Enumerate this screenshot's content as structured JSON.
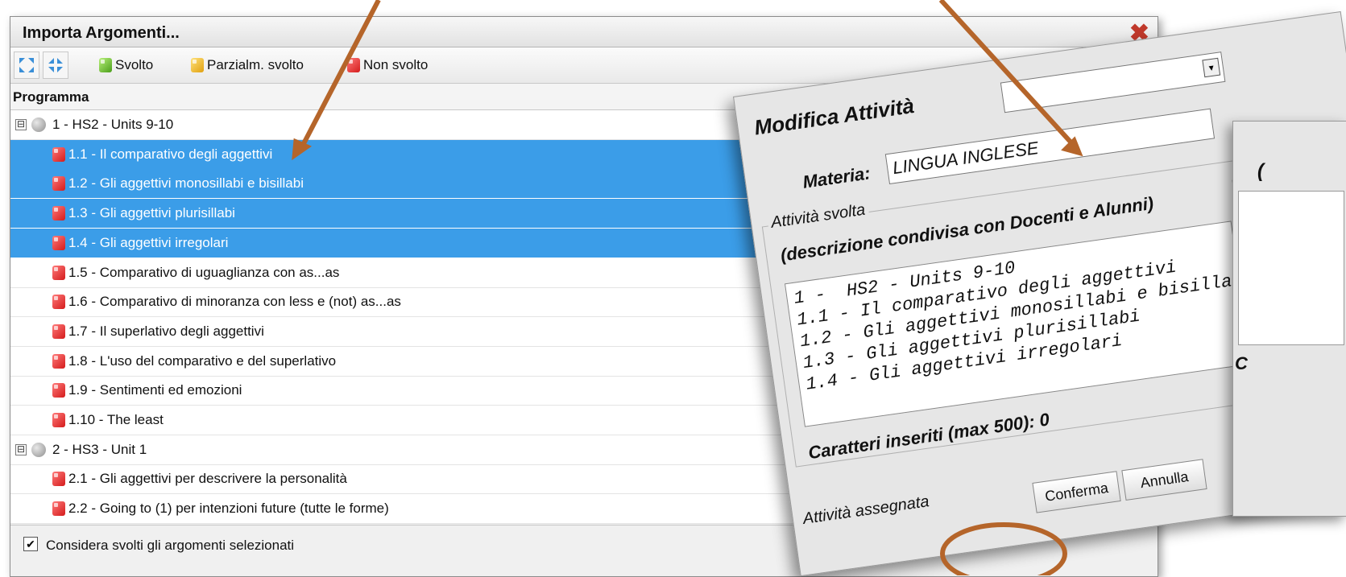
{
  "import_dialog": {
    "title": "Importa Argomenti...",
    "toolbar": {
      "expand_icon": "expand-all-icon",
      "collapse_icon": "collapse-all-icon",
      "done": "Svolto",
      "partial": "Parzialm. svolto",
      "not_done": "Non svolto"
    },
    "column_header": "Programma",
    "rows": [
      {
        "label": "1 - HS2 - Units 9-10",
        "kind": "group",
        "expander": "⊟"
      },
      {
        "label": "1.1 - Il comparativo degli aggettivi",
        "kind": "item",
        "selected": true
      },
      {
        "label": "1.2 - Gli aggettivi monosillabi e bisillabi",
        "kind": "item",
        "selected": true
      },
      {
        "label": "1.3 - Gli aggettivi plurisillabi",
        "kind": "item",
        "selected": true
      },
      {
        "label": "1.4 - Gli aggettivi irregolari",
        "kind": "item",
        "selected": true
      },
      {
        "label": "1.5 - Comparativo di uguaglianza con as...as",
        "kind": "item"
      },
      {
        "label": "1.6 - Comparativo di minoranza con less e (not) as...as",
        "kind": "item"
      },
      {
        "label": "1.7 - Il superlativo degli aggettivi",
        "kind": "item"
      },
      {
        "label": "1.8 - L'uso del comparativo e del superlativo",
        "kind": "item"
      },
      {
        "label": "1.9 - Sentimenti ed emozioni",
        "kind": "item"
      },
      {
        "label": "1.10 - The least",
        "kind": "item"
      },
      {
        "label": "2 - HS3 - Unit 1",
        "kind": "group",
        "expander": "⊟"
      },
      {
        "label": "2.1 - Gli aggettivi per descrivere la personalità",
        "kind": "item"
      },
      {
        "label": "2.2 - Going to (1) per intenzioni future (tutte le forme)",
        "kind": "item"
      }
    ],
    "footer": {
      "checkbox_checked": true,
      "checkbox_mark": "✔",
      "checkbox_label": "Considera svolti gli argomenti selezionati"
    }
  },
  "modifica_dialog": {
    "title": "Modifica Attività",
    "materia_label": "Materia:",
    "materia_value": "LINGUA INGLESE",
    "attivita_svolta_legend": "Attività svolta",
    "description_note": "(descrizione condivisa con Docenti e Alunni)",
    "description_text": "1 -  HS2 - Units 9-10\n1.1 - Il comparativo degli aggettivi\n1.2 - Gli aggettivi monosillabi e bisillabi\n1.3 - Gli aggettivi plurisillabi\n1.4 - Gli aggettivi irregolari",
    "chars_label": "Caratteri inseriti (max 500): 0",
    "attivita_assegnata_legend": "Attività assegnata",
    "confirm_label": "Conferma",
    "cancel_label": "Annulla",
    "select_arrow": "▾"
  },
  "third_dialog": {
    "paren": "(",
    "c_label": "C"
  },
  "colors": {
    "selection": "#3b9de8",
    "annotation_arrow": "#b5652a"
  }
}
